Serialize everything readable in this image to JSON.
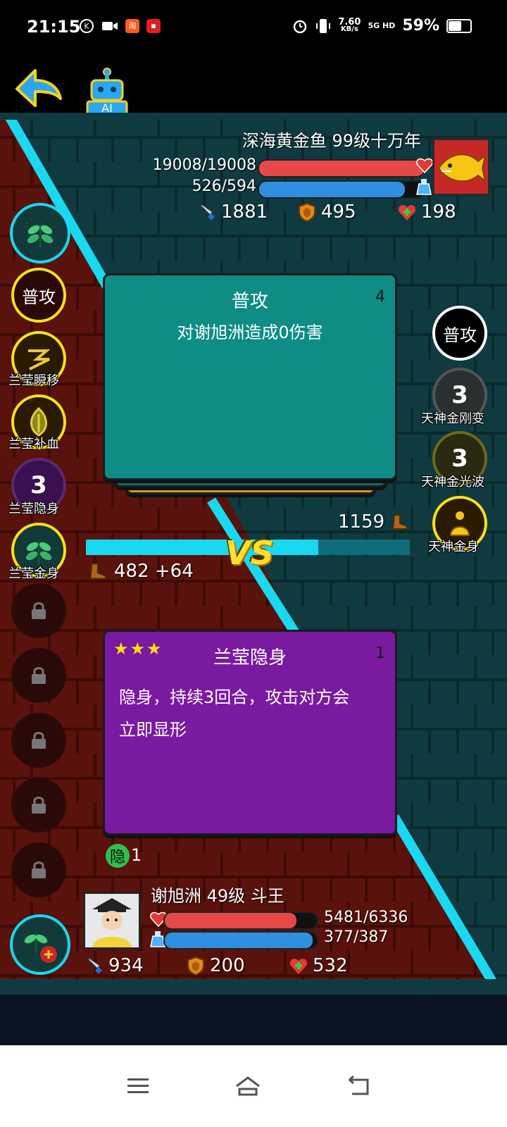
{
  "status_bar": {
    "time": "21:15",
    "net_speed": "7.60",
    "net_unit": "KB/s",
    "net_type": "5G HD",
    "battery": "59%",
    "battery_level": 0.59,
    "icons": [
      "k-icon",
      "video-icon",
      "taobao-icon",
      "app-icon",
      "alarm-icon",
      "vibrate-icon"
    ]
  },
  "toolbar": {
    "back_icon": "back-arrow-icon",
    "ai_label": "AI"
  },
  "enemy": {
    "name": "深海黄金鱼 99级十万年",
    "hp_text": "19008/19008",
    "hp_fraction": 1.0,
    "mp_text": "526/594",
    "mp_fraction": 0.885,
    "attack": "1881",
    "defense": "495",
    "heal": "198",
    "speed": "1159",
    "skills": [
      {
        "label": "普攻",
        "text": "普攻"
      },
      {
        "label": "天神金刚变",
        "cooldown": "3"
      },
      {
        "label": "天神金光波",
        "cooldown": "3"
      },
      {
        "label": "天神金身"
      }
    ]
  },
  "player": {
    "name": "谢旭洲 49级 斗王",
    "hp_text": "5481/6336",
    "hp_fraction": 0.865,
    "mp_text": "377/387",
    "mp_fraction": 0.974,
    "attack": "934",
    "defense": "200",
    "heal": "532",
    "speed": "482 +64",
    "status_badge": "隐",
    "status_count": "1",
    "skills": [
      {
        "label": "普攻",
        "text": "普攻"
      },
      {
        "label": "兰莹瞬移"
      },
      {
        "label": "兰莹补血"
      },
      {
        "label": "兰莹隐身",
        "cooldown": "3"
      },
      {
        "label": "兰莹金身"
      }
    ],
    "locked_slots": 5
  },
  "enemy_card": {
    "title": "普攻",
    "count": "4",
    "description": "对谢旭洲造成0伤害"
  },
  "player_card": {
    "title": "兰莹隐身",
    "count": "1",
    "stars": "★★★",
    "description_line1": "隐身，持续3回合，攻击对方会",
    "description_line2": "立即显形"
  },
  "vs_label": "VS",
  "speed_progress": {
    "player_fraction": 0.294,
    "enemy_fraction": 0.706
  },
  "colors": {
    "cyan": "#19d8f0",
    "teal_card": "#0e8c86",
    "purple_card": "#7a1aa0",
    "hp_red": "#e54848",
    "mp_blue": "#2f8fe0"
  }
}
